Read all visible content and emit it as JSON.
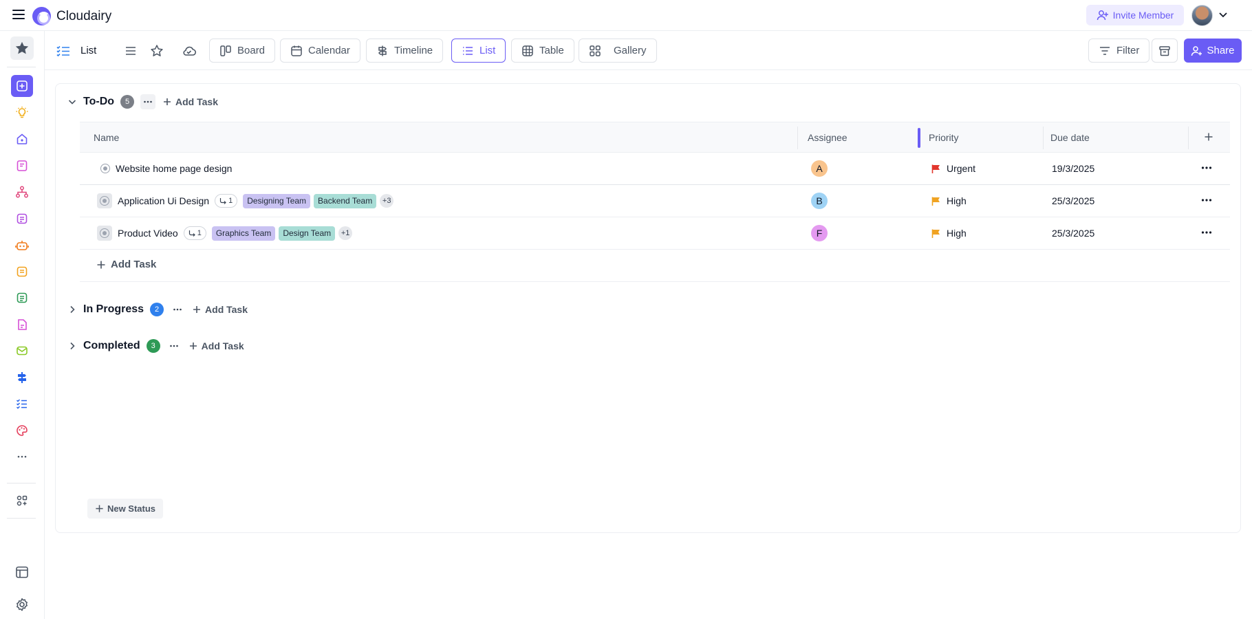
{
  "app": {
    "name": "Cloudairy"
  },
  "header": {
    "invite_label": "Invite Member"
  },
  "toolbar": {
    "view_title": "List",
    "views": [
      {
        "label": "Board"
      },
      {
        "label": "Calendar"
      },
      {
        "label": "Timeline"
      },
      {
        "label": "List"
      },
      {
        "label": "Table"
      },
      {
        "label": "Gallery"
      }
    ],
    "active_view": "List",
    "filter_label": "Filter",
    "share_label": "Share"
  },
  "rail": {
    "icons": [
      "star-icon",
      "add-square-icon",
      "bulb-icon",
      "home-icon",
      "notes-icon",
      "hierarchy-icon",
      "document-icon",
      "robot-icon",
      "sticky-note-icon",
      "spreadsheet-icon",
      "file-icon",
      "mail-icon",
      "signpost-icon",
      "checklist-icon",
      "palette-icon",
      "more-icon",
      "apps-icon",
      "layout-icon",
      "settings-icon"
    ]
  },
  "groups": {
    "todo": {
      "title": "To-Do",
      "count": "5",
      "add_label": "Add Task",
      "badge_color": "#7b7f87"
    },
    "in_progress": {
      "title": "In Progress",
      "count": "2",
      "add_label": "Add Task",
      "badge_color": "#2f80ed"
    },
    "completed": {
      "title": "Completed",
      "count": "3",
      "add_label": "Add Task",
      "badge_color": "#2e9a56"
    }
  },
  "table": {
    "columns": {
      "name": "Name",
      "assignee": "Assignee",
      "priority": "Priority",
      "due": "Due date"
    },
    "rows": [
      {
        "name": "Website home page design",
        "subtasks": "",
        "tags": [],
        "more": "",
        "assignee": "A",
        "assignee_color": "#f9c48d",
        "priority": "Urgent",
        "priority_color": "#e2372d",
        "due": "19/3/2025"
      },
      {
        "name": "Application Ui Design",
        "subtasks": "1",
        "tags": [
          {
            "label": "Designing Team",
            "color": "#c9c2f2"
          },
          {
            "label": "Backend Team",
            "color": "#a8ddd6"
          }
        ],
        "more": "+3",
        "assignee": "B",
        "assignee_color": "#9fd3f5",
        "priority": "High",
        "priority_color": "#f0a322",
        "due": "25/3/2025"
      },
      {
        "name": "Product Video",
        "subtasks": "1",
        "tags": [
          {
            "label": "Graphics Team",
            "color": "#c9c2f2"
          },
          {
            "label": "Design Team",
            "color": "#a8ddd6"
          }
        ],
        "more": "+1",
        "assignee": "F",
        "assignee_color": "#e49af0",
        "priority": "High",
        "priority_color": "#f0a322",
        "due": "25/3/2025"
      }
    ],
    "add_task_label": "Add Task"
  },
  "new_status_label": "New Status"
}
